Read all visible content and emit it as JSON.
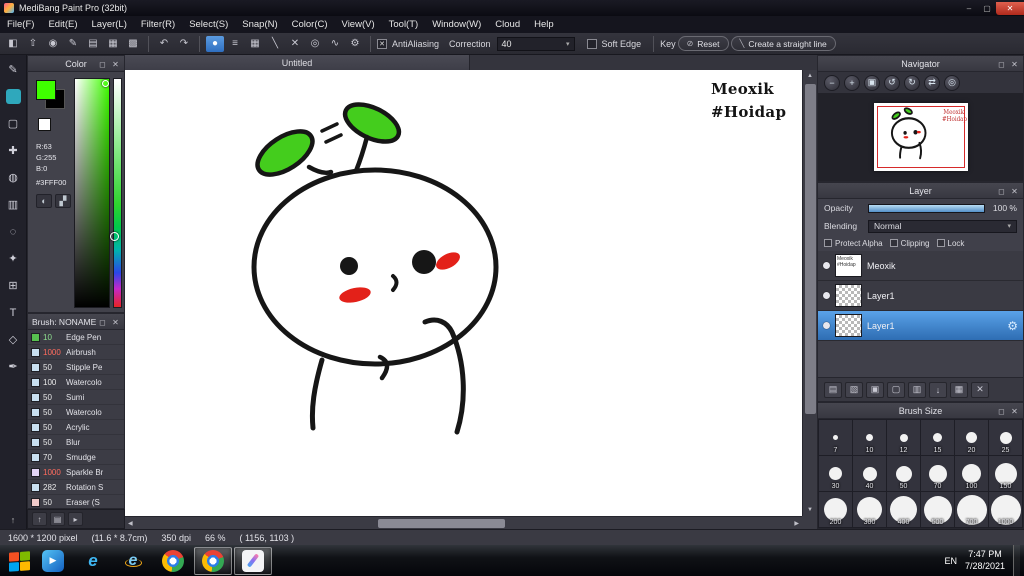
{
  "window": {
    "title": "MediBang Paint Pro (32bit)"
  },
  "titlebar": {
    "minimize": "–",
    "maximize": "▢",
    "close": "✕"
  },
  "icons": {
    "popout": "◻",
    "close": "✕",
    "caret": "▾",
    "check": "✕",
    "up": "▲",
    "down": "▼",
    "left": "◀",
    "right": "▶"
  },
  "menu_items": [
    "File(F)",
    "Edit(E)",
    "Layer(L)",
    "Filter(R)",
    "Select(S)",
    "Snap(N)",
    "Color(C)",
    "View(V)",
    "Tool(T)",
    "Window(W)",
    "Cloud",
    "Help"
  ],
  "toolbar": {
    "file_icons": [
      {
        "name": "new-canvas-icon",
        "glyph": "◧"
      },
      {
        "name": "export-icon",
        "glyph": "⇧"
      },
      {
        "name": "comment-icon",
        "glyph": "◉"
      },
      {
        "name": "pen-settings-icon",
        "glyph": "✎"
      },
      {
        "name": "document-icon",
        "glyph": "▤"
      },
      {
        "name": "grid-icon",
        "glyph": "▦"
      },
      {
        "name": "table-icon",
        "glyph": "▩"
      }
    ],
    "undo_glyph": "↶",
    "redo_glyph": "↷",
    "option_icons": [
      {
        "name": "brush-shape-icon",
        "glyph": "●",
        "selected": true
      },
      {
        "name": "parallel-lines-icon",
        "glyph": "≡"
      },
      {
        "name": "halftone-icon",
        "glyph": "▦"
      },
      {
        "name": "diagonal-line-icon",
        "glyph": "╲"
      },
      {
        "name": "cross-icon",
        "glyph": "✕"
      },
      {
        "name": "concentric-circles-icon",
        "glyph": "◎"
      },
      {
        "name": "curve-icon",
        "glyph": "∿"
      },
      {
        "name": "settings-icon",
        "glyph": "⚙"
      }
    ],
    "antialiasing_label": "AntiAliasing",
    "correction_label": "Correction",
    "correction_value": "40",
    "soft_edge_label": "Soft Edge",
    "key_label": "Key",
    "reset_label": "Reset",
    "reset_icon_glyph": "⊘",
    "straight_line_label": "Create a straight line",
    "straight_line_icon_glyph": "╲"
  },
  "tools": [
    {
      "name": "pen-tool",
      "glyph": "✎"
    },
    {
      "name": "brush-tool",
      "glyph": "",
      "fill": "#2fa8bc",
      "selected": true
    },
    {
      "name": "marquee-tool",
      "glyph": "▢"
    },
    {
      "name": "move-tool",
      "glyph": "✚"
    },
    {
      "name": "fill-tool",
      "glyph": "◍"
    },
    {
      "name": "gradient-tool",
      "glyph": "▥"
    },
    {
      "name": "lasso-tool",
      "glyph": "◌"
    },
    {
      "name": "magic-wand-tool",
      "glyph": "✦"
    },
    {
      "name": "shape-tool",
      "glyph": "⊞"
    },
    {
      "name": "text-tool",
      "glyph": "T"
    },
    {
      "name": "pan-tool",
      "glyph": "◇"
    },
    {
      "name": "eyedropper-tool",
      "glyph": "✒"
    }
  ],
  "tool_strip_footer_glyph": "↑",
  "color_panel": {
    "title": "Color",
    "r_label": "R:63",
    "g_label": "G:255",
    "b_label": "B:0",
    "hex": "#3FFF00",
    "foreground": "#3FFF00",
    "background": "#000000",
    "wheel_icon_glyph": "◐",
    "swap_icon_glyph": "▞"
  },
  "brush_panel": {
    "title": "Brush: NONAME",
    "brushes": [
      {
        "size": "10",
        "name": "Edge Pen",
        "num_color": "#8fe08f",
        "swatch": "#57c04f"
      },
      {
        "size": "1000",
        "name": "Airbrush",
        "num_color": "#ff6b5e",
        "swatch": "#c8dff0"
      },
      {
        "size": "50",
        "name": "Stipple Pe",
        "num_color": "#e8e8e8",
        "swatch": "#c8dff0"
      },
      {
        "size": "100",
        "name": "Watercolo",
        "num_color": "#e8e8e8",
        "swatch": "#c8dff0"
      },
      {
        "size": "50",
        "name": "Sumi",
        "num_color": "#e8e8e8",
        "swatch": "#c8dff0"
      },
      {
        "size": "50",
        "name": "Watercolo",
        "num_color": "#e8e8e8",
        "swatch": "#c8dff0"
      },
      {
        "size": "50",
        "name": "Acrylic",
        "num_color": "#e8e8e8",
        "swatch": "#c8dff0"
      },
      {
        "size": "50",
        "name": "Blur",
        "num_color": "#e8e8e8",
        "swatch": "#c8dff0"
      },
      {
        "size": "70",
        "name": "Smudge",
        "num_color": "#e8e8e8",
        "swatch": "#c8dff0"
      },
      {
        "size": "1000",
        "name": "Sparkle Br",
        "num_color": "#ff6b5e",
        "swatch": "#e3d4f5"
      },
      {
        "size": "282",
        "name": "Rotation S",
        "num_color": "#e8e8e8",
        "swatch": "#c8dff0"
      },
      {
        "size": "50",
        "name": "Eraser (S",
        "num_color": "#e8e8e8",
        "swatch": "#f0c9c9"
      }
    ]
  },
  "brush_footer_icons": [
    {
      "name": "list-up-icon",
      "glyph": "↑"
    },
    {
      "name": "add-brush-icon",
      "glyph": "▤"
    },
    {
      "name": "brush-menu-icon",
      "glyph": "▸"
    }
  ],
  "canvas": {
    "tab": "Untitled",
    "signature_line1": "Meoxik",
    "signature_line2": "#Hoidap"
  },
  "navigator": {
    "title": "Navigator",
    "buttons": [
      {
        "name": "zoom-out-icon",
        "glyph": "−"
      },
      {
        "name": "zoom-in-icon",
        "glyph": "+"
      },
      {
        "name": "fit-view-icon",
        "glyph": "▣"
      },
      {
        "name": "rotate-left-icon",
        "glyph": "↺"
      },
      {
        "name": "rotate-right-icon",
        "glyph": "↻"
      },
      {
        "name": "flip-icon",
        "glyph": "⇄"
      },
      {
        "name": "reset-view-icon",
        "glyph": "◎"
      }
    ]
  },
  "layer_panel": {
    "title": "Layer",
    "opacity_label": "Opacity",
    "opacity_value": "100 %",
    "blending_label": "Blending",
    "blending_value": "Normal",
    "protect_alpha_label": "Protect Alpha",
    "clipping_label": "Clipping",
    "lock_label": "Lock",
    "layers": [
      {
        "name": "Meoxik",
        "thumb": "meoxik",
        "thumb_line1": "Meoxik",
        "thumb_line2": "#Hoidap"
      },
      {
        "name": "Layer1",
        "thumb": "checker"
      },
      {
        "name": "Layer1",
        "thumb": "checker",
        "selected": true,
        "gear_glyph": "⚙"
      }
    ],
    "footer_icons": [
      {
        "name": "add-layer-icon",
        "glyph": "▤"
      },
      {
        "name": "add-folder-icon",
        "glyph": "▧"
      },
      {
        "name": "duplicate-layer-icon",
        "glyph": "▣"
      },
      {
        "name": "folder-icon",
        "glyph": "▢"
      },
      {
        "name": "copy-layer-icon",
        "glyph": "▥"
      },
      {
        "name": "merge-down-icon",
        "glyph": "↓"
      },
      {
        "name": "clear-layer-icon",
        "glyph": "▦"
      },
      {
        "name": "delete-layer-icon",
        "glyph": "✕"
      }
    ]
  },
  "brush_size_panel": {
    "title": "Brush Size",
    "sizes": [
      7,
      10,
      12,
      15,
      20,
      25,
      30,
      40,
      50,
      70,
      100,
      150,
      200,
      300,
      400,
      500,
      700,
      1000
    ]
  },
  "status_bar": {
    "size": "1600 * 1200 pixel",
    "dimensions": "(11.6 * 8.7cm)",
    "dpi": "350 dpi",
    "zoom": "66 %",
    "coords": "( 1156, 1103 )"
  },
  "taskbar": {
    "apps": [
      {
        "name": "media-player-icon",
        "type": "media",
        "glyph": "▶"
      },
      {
        "name": "edge-icon",
        "type": "edge",
        "glyph": "e"
      },
      {
        "name": "internet-explorer-icon",
        "type": "ie",
        "glyph": "e"
      },
      {
        "name": "chrome-icon",
        "type": "chrome",
        "glyph": ""
      },
      {
        "name": "chrome-window-icon",
        "type": "chrome",
        "glyph": "",
        "active": true
      },
      {
        "name": "medibang-window-icon",
        "type": "medibang",
        "glyph": "",
        "active": true
      }
    ],
    "language": "EN",
    "time": "7:47 PM",
    "date": "7/28/2021"
  }
}
